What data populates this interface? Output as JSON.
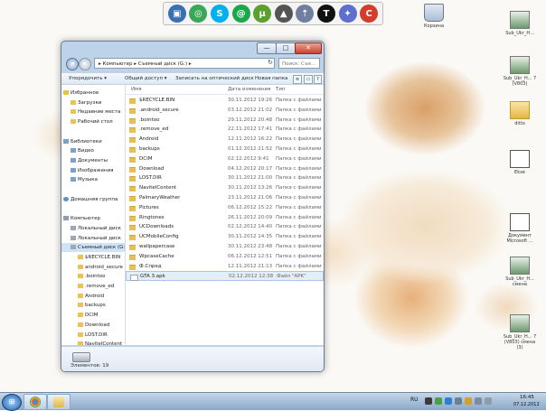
{
  "dock": {
    "icons": [
      {
        "name": "explorer-icon",
        "color": "#3a6fb3",
        "glyph": "▣"
      },
      {
        "name": "chrome-icon",
        "color": "#3aa757",
        "glyph": "◎"
      },
      {
        "name": "skype-icon",
        "color": "#00aff0",
        "glyph": "S"
      },
      {
        "name": "at-icon",
        "color": "#1aa84a",
        "glyph": "@"
      },
      {
        "name": "utorrent-icon",
        "color": "#5aa02c",
        "glyph": "µ"
      },
      {
        "name": "aimp-icon",
        "color": "#555555",
        "glyph": "▲"
      },
      {
        "name": "rocket-icon",
        "color": "#6e7fa0",
        "glyph": "⇡"
      },
      {
        "name": "tshirt-icon",
        "color": "#111111",
        "glyph": "T"
      },
      {
        "name": "puzzle-icon",
        "color": "#5f6fcf",
        "glyph": "✦"
      },
      {
        "name": "ccleaner-icon",
        "color": "#d33d2b",
        "glyph": "C"
      }
    ]
  },
  "desktop_icons": [
    {
      "label": "Корзина",
      "kind": "trash"
    },
    {
      "label": "Sub_Ukr_H...",
      "kind": "app"
    },
    {
      "label": "Sub_Ukr_H... 7 (V803)",
      "kind": "app"
    },
    {
      "label": "ditto",
      "kind": "folder"
    },
    {
      "label": "Ekxe",
      "kind": "doc"
    },
    {
      "label": "Документ Microsoft ...",
      "kind": "doc"
    },
    {
      "label": "Sub_Ukr_H... смена",
      "kind": "app"
    },
    {
      "label": "Sub_Ukr_H... 7 (V803) смена (3)",
      "kind": "app"
    }
  ],
  "window": {
    "controls": {
      "minimize": "—",
      "maximize": "□",
      "close": "✕"
    },
    "address": "▸ Компьютер ▸ Съемный диск (G:) ▸",
    "search_placeholder": "Поиск: Съе...",
    "toolbar": {
      "organize": "Упорядочить ▾",
      "share": "Общий доступ ▾",
      "burn": "Записать на оптический диск",
      "new_folder": "Новая папка"
    },
    "nav": [
      {
        "label": "Избранное",
        "ico": "fav",
        "indent": 2
      },
      {
        "label": "Загрузки",
        "ico": "fold",
        "indent": 10
      },
      {
        "label": "Недавние места",
        "ico": "fold",
        "indent": 10
      },
      {
        "label": "Рабочий стол",
        "ico": "fold",
        "indent": 10
      },
      {
        "label": "",
        "ico": "",
        "indent": 0
      },
      {
        "label": "Библиотеки",
        "ico": "lib",
        "indent": 2
      },
      {
        "label": "Видео",
        "ico": "lib",
        "indent": 10
      },
      {
        "label": "Документы",
        "ico": "lib",
        "indent": 10
      },
      {
        "label": "Изображения",
        "ico": "lib",
        "indent": 10
      },
      {
        "label": "Музыка",
        "ico": "lib",
        "indent": 10
      },
      {
        "label": "",
        "ico": "",
        "indent": 0
      },
      {
        "label": "Домашняя группа",
        "ico": "net",
        "indent": 2
      },
      {
        "label": "",
        "ico": "",
        "indent": 0
      },
      {
        "label": "Компьютер",
        "ico": "comp",
        "indent": 2
      },
      {
        "label": "Локальный диск",
        "ico": "drive",
        "indent": 10
      },
      {
        "label": "Локальный диск",
        "ico": "drive",
        "indent": 10
      },
      {
        "label": "Съемный диск (G:)",
        "ico": "drive",
        "indent": 10
      },
      {
        "label": "$RECYCLE.BIN",
        "ico": "fold",
        "indent": 18
      },
      {
        "label": "android_secure",
        "ico": "fold",
        "indent": 18
      },
      {
        "label": ".bointoo",
        "ico": "fold",
        "indent": 18
      },
      {
        "label": ".remove_ed",
        "ico": "fold",
        "indent": 18
      },
      {
        "label": "Android",
        "ico": "fold",
        "indent": 18
      },
      {
        "label": "backups",
        "ico": "fold",
        "indent": 18
      },
      {
        "label": "DCIM",
        "ico": "fold",
        "indent": 18
      },
      {
        "label": "Download",
        "ico": "fold",
        "indent": 18
      },
      {
        "label": "LOST.DIR",
        "ico": "fold",
        "indent": 18
      },
      {
        "label": "NavitelContent",
        "ico": "fold",
        "indent": 18
      }
    ],
    "columns": {
      "name": "Имя",
      "date": "Дата изменения",
      "type": "Тип"
    },
    "files": [
      {
        "name": "$RECYCLE.BIN",
        "date": "30.11.2012 19:26",
        "type": "Папка с файлами",
        "doc": false
      },
      {
        "name": ".android_secure",
        "date": "03.12.2012 21:02",
        "type": "Папка с файлами",
        "doc": false
      },
      {
        "name": ".bointoo",
        "date": "29.11.2012 20:48",
        "type": "Папка с файлами",
        "doc": false
      },
      {
        "name": ".remove_ed",
        "date": "22.11.2012 17:41",
        "type": "Папка с файлами",
        "doc": false
      },
      {
        "name": "Android",
        "date": "12.11.2012 16:22",
        "type": "Папка с файлами",
        "doc": false
      },
      {
        "name": "backups",
        "date": "01.12.2012 21:52",
        "type": "Папка с файлами",
        "doc": false
      },
      {
        "name": "DCIM",
        "date": "02.12.2012 9:41",
        "type": "Папка с файлами",
        "doc": false
      },
      {
        "name": "Download",
        "date": "04.12.2012 20:17",
        "type": "Папка с файлами",
        "doc": false
      },
      {
        "name": "LOST.DIR",
        "date": "30.11.2012 21:00",
        "type": "Папка с файлами",
        "doc": false
      },
      {
        "name": "NavitelContent",
        "date": "30.11.2012 13:26",
        "type": "Папка с файлами",
        "doc": false
      },
      {
        "name": "PalmaryWeather",
        "date": "23.11.2012 21:06",
        "type": "Папка с файлами",
        "doc": false
      },
      {
        "name": "Pictures",
        "date": "06.12.2012 15:22",
        "type": "Папка с файлами",
        "doc": false
      },
      {
        "name": "Ringtones",
        "date": "26.11.2012 20:09",
        "type": "Папка с файлами",
        "doc": false
      },
      {
        "name": "UCDownloads",
        "date": "02.12.2012 14:40",
        "type": "Папка с файлами",
        "doc": false
      },
      {
        "name": "UCMobileConfig",
        "date": "30.11.2012 14:35",
        "type": "Папка с файлами",
        "doc": false
      },
      {
        "name": "wallpapercase",
        "date": "30.11.2012 23:48",
        "type": "Папка с файлами",
        "doc": false
      },
      {
        "name": "WpcaseCache",
        "date": "06.12.2012 12:51",
        "type": "Папка с файлами",
        "doc": false
      },
      {
        "name": "Ф.Спред",
        "date": "12.11.2012 21:13",
        "type": "Папка с файлами",
        "doc": false
      },
      {
        "name": "GTA 3.apk",
        "date": "02.12.2012 12:38",
        "type": "Файл \"APK\"",
        "doc": true
      }
    ],
    "status": "Элементов: 19"
  },
  "taskbar": {
    "start": "⊞",
    "lang": "RU",
    "time": "16:45",
    "date": "07.12.2012"
  }
}
